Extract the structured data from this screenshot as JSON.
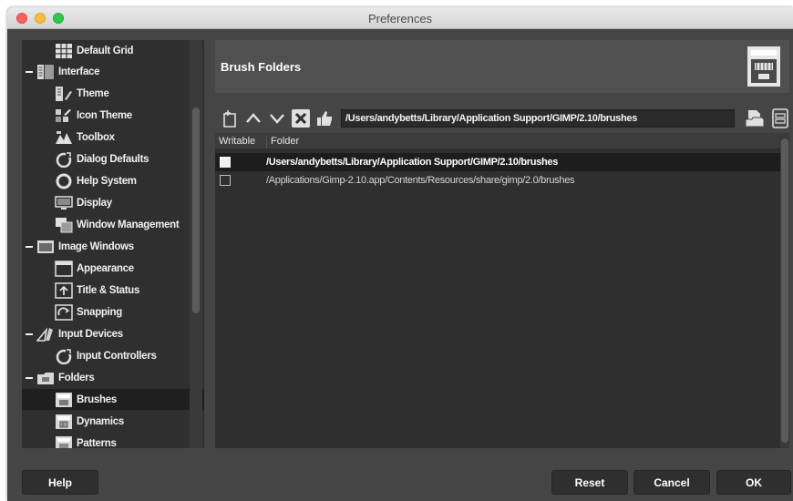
{
  "window": {
    "title": "Preferences"
  },
  "tree": {
    "items": [
      {
        "label": "Default Grid",
        "icon": "grid-icon",
        "level": 1
      },
      {
        "label": "Interface",
        "icon": "interface-icon",
        "level": 0,
        "expanded": true
      },
      {
        "label": "Theme",
        "icon": "theme-icon",
        "level": 1
      },
      {
        "label": "Icon Theme",
        "icon": "icon-theme-icon",
        "level": 1
      },
      {
        "label": "Toolbox",
        "icon": "toolbox-icon",
        "level": 1
      },
      {
        "label": "Dialog Defaults",
        "icon": "dialog-defaults-icon",
        "level": 1
      },
      {
        "label": "Help System",
        "icon": "help-system-icon",
        "level": 1
      },
      {
        "label": "Display",
        "icon": "display-icon",
        "level": 1
      },
      {
        "label": "Window Management",
        "icon": "window-management-icon",
        "level": 1
      },
      {
        "label": "Image Windows",
        "icon": "image-windows-icon",
        "level": 0,
        "expanded": true
      },
      {
        "label": "Appearance",
        "icon": "appearance-icon",
        "level": 1
      },
      {
        "label": "Title & Status",
        "icon": "title-status-icon",
        "level": 1
      },
      {
        "label": "Snapping",
        "icon": "snapping-icon",
        "level": 1
      },
      {
        "label": "Input Devices",
        "icon": "input-devices-icon",
        "level": 0,
        "expanded": true
      },
      {
        "label": "Input Controllers",
        "icon": "input-controllers-icon",
        "level": 1
      },
      {
        "label": "Folders",
        "icon": "folders-icon",
        "level": 0,
        "expanded": true
      },
      {
        "label": "Brushes",
        "icon": "brushes-icon",
        "level": 1,
        "selected": true
      },
      {
        "label": "Dynamics",
        "icon": "dynamics-icon",
        "level": 1
      },
      {
        "label": "Patterns",
        "icon": "patterns-icon",
        "level": 1
      }
    ]
  },
  "header": {
    "title": "Brush Folders"
  },
  "toolbar": {
    "path": "/Users/andybetts/Library/Application Support/GIMP/2.10/brushes"
  },
  "list": {
    "columns": {
      "writable": "Writable",
      "folder": "Folder"
    },
    "rows": [
      {
        "writable": true,
        "folder": "/Users/andybetts/Library/Application Support/GIMP/2.10/brushes",
        "selected": true
      },
      {
        "writable": false,
        "folder": "/Applications/Gimp-2.10.app/Contents/Resources/share/gimp/2.0/brushes",
        "selected": false
      }
    ]
  },
  "buttons": {
    "help": "Help",
    "reset": "Reset",
    "cancel": "Cancel",
    "ok": "OK"
  },
  "colors": {
    "background": "#454545",
    "panel": "#2f2f2f",
    "selected": "#1f1f1f",
    "text": "#f0f0f0"
  }
}
